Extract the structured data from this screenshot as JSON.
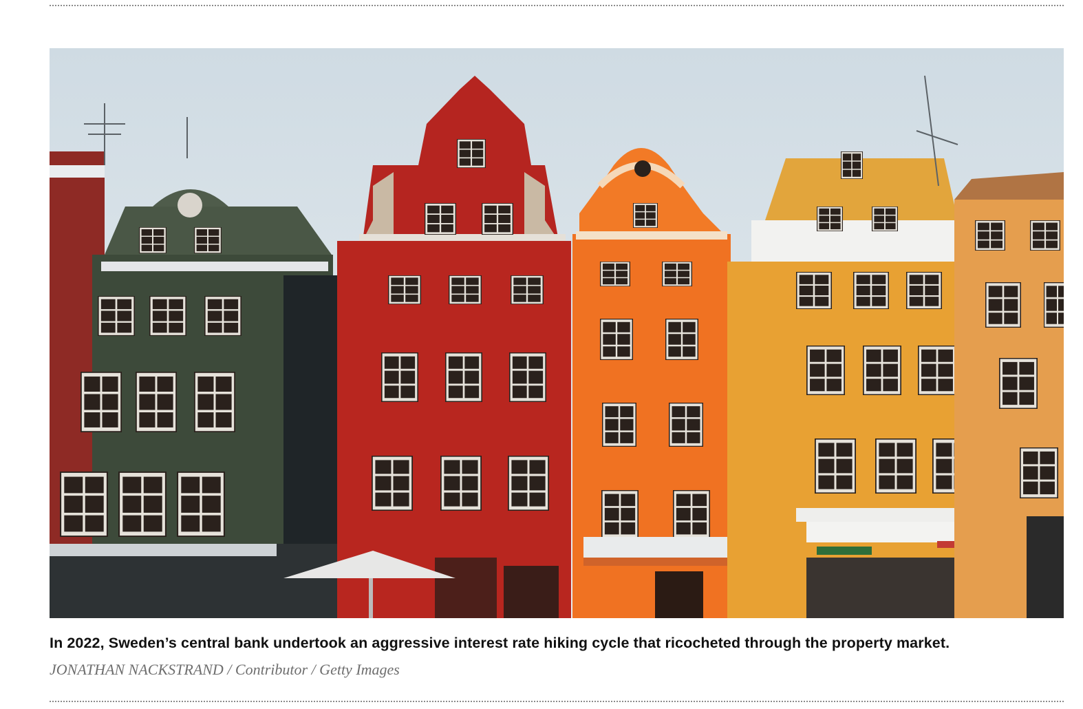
{
  "figure": {
    "caption": "In 2022, Sweden’s central bank undertook an aggressive interest rate hiking cycle that ricocheted through the property market.",
    "credit": "JONATHAN NACKSTRAND / Contributor / Getty Images"
  },
  "colors": {
    "red_building": "#b8261f",
    "orange_building": "#f07222",
    "yellow_building": "#e8a133",
    "green_building": "#3d4a3a",
    "sky": "#d9e3ea"
  }
}
